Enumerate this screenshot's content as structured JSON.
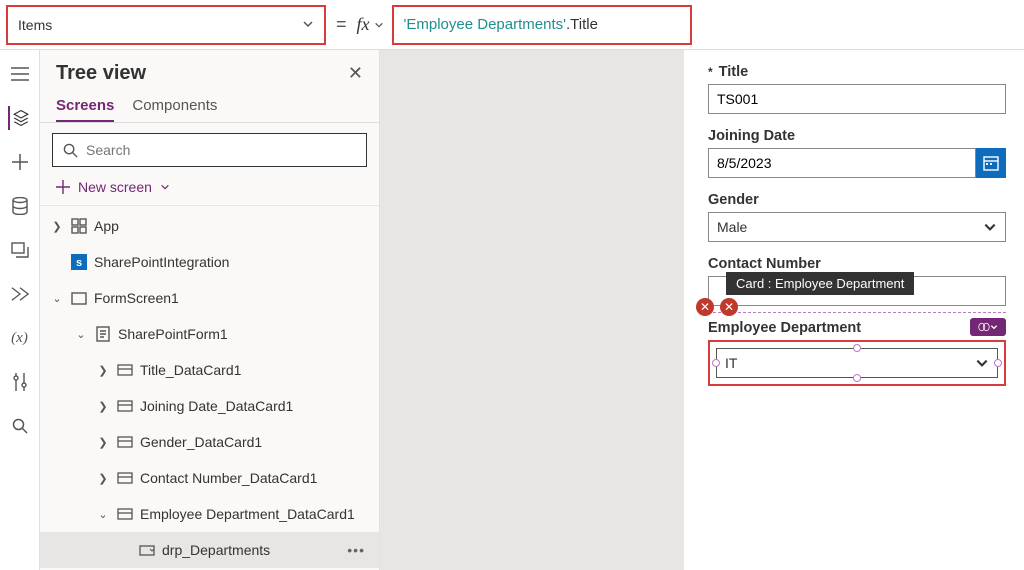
{
  "formula": {
    "property": "Items",
    "string_part": "'Employee Departments'",
    "rest_part": ".Title"
  },
  "tree": {
    "title": "Tree view",
    "tabs": {
      "screens": "Screens",
      "components": "Components"
    },
    "search_placeholder": "Search",
    "new_screen": "New screen",
    "nodes": {
      "app": "App",
      "spi": "SharePointIntegration",
      "screen": "FormScreen1",
      "form": "SharePointForm1",
      "title_dc": "Title_DataCard1",
      "jd_dc": "Joining Date_DataCard1",
      "gender_dc": "Gender_DataCard1",
      "contact_dc": "Contact Number_DataCard1",
      "dept_dc": "Employee Department_DataCard1",
      "drp_dept": "drp_Departments"
    }
  },
  "form": {
    "title": {
      "label": "Title",
      "value": "TS001"
    },
    "joining": {
      "label": "Joining Date",
      "value": "8/5/2023"
    },
    "gender": {
      "label": "Gender",
      "value": "Male"
    },
    "contact": {
      "label": "Contact Number",
      "value": ""
    },
    "dept": {
      "label": "Employee Department",
      "value": "IT"
    },
    "tooltip": "Card : Employee Department"
  }
}
